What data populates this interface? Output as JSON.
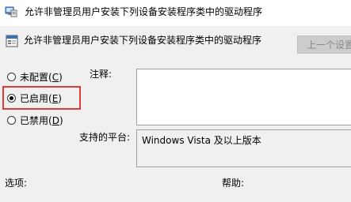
{
  "window": {
    "title": "允许非管理员用户安装下列设备安装程序类中的驱动程序"
  },
  "header": {
    "setting_title": "允许非管理员用户安装下列设备安装程序类中的驱动程序",
    "prev_button_label": "上一个设置"
  },
  "state": {
    "options": [
      {
        "label_prefix": "未配置(",
        "accel": "C",
        "label_suffix": ")",
        "checked": false
      },
      {
        "label_prefix": "已启用(",
        "accel": "E",
        "label_suffix": ")",
        "checked": true
      },
      {
        "label_prefix": "已禁用(",
        "accel": "D",
        "label_suffix": ")",
        "checked": false
      }
    ]
  },
  "comment": {
    "label": "注释:",
    "value": ""
  },
  "platform": {
    "label": "支持的平台:",
    "value": "Windows Vista 及以上版本"
  },
  "footer": {
    "options_label": "选项:",
    "help_label": "帮助:"
  },
  "colors": {
    "highlight": "#e23b3b",
    "window_bg": "#f0f0f0"
  },
  "icons": {
    "title_icon": "group-policy-icon",
    "setting_icon": "policy-setting-icon"
  }
}
